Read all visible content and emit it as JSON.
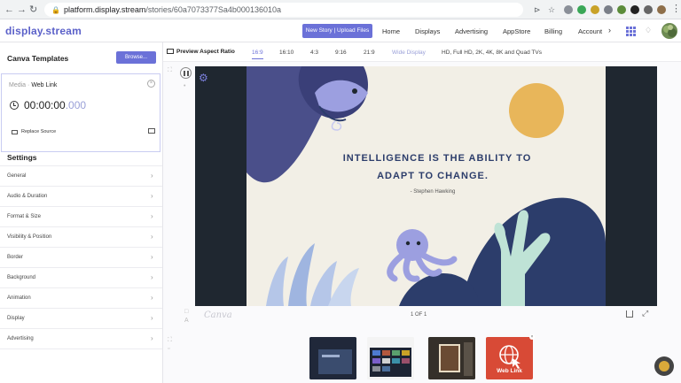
{
  "browser": {
    "url_host": "platform.display.stream",
    "url_path": "/stories/60a7073377Sa4b000136010a"
  },
  "app": {
    "logo": "display.stream",
    "new_story_button": "New Story | Upload Files",
    "nav": [
      "Home",
      "Displays",
      "Advertising",
      "AppStore",
      "Billing",
      "Account"
    ]
  },
  "left_panel": {
    "title": "Canva Templates",
    "browse_button": "Browse...",
    "media_prefix": "Media",
    "media_type": "Web Link",
    "timer_main": "00:00:00",
    "timer_ms": ".000",
    "replace_source": "Replace Source",
    "settings_title": "Settings",
    "settings_items": [
      "General",
      "Audio & Duration",
      "Format & Size",
      "Visibility & Position",
      "Border",
      "Background",
      "Animation",
      "Display",
      "Advertising"
    ]
  },
  "preview_toolbar": {
    "label": "Preview Aspect Ratio",
    "ratios": [
      "16:9",
      "16:10",
      "4:3",
      "9:16",
      "21:9"
    ],
    "active_ratio": "16:9",
    "wide_display": "Wide Display",
    "hd_options": "HD, Full HD, 2K, 4K, 8K and Quad TVs"
  },
  "slide": {
    "quote_line1": "INTELLIGENCE IS THE ABILITY TO",
    "quote_line2": "ADAPT TO CHANGE.",
    "author": "- Stephen Hawking",
    "canva_watermark": "Canva",
    "pager": "1 OF 1"
  },
  "thumbnails": {
    "web_link_label": "Web Link"
  },
  "colors": {
    "accent": "#6b71d8",
    "slide_bg": "#f2efe6",
    "navy": "#2c3d6b",
    "lavender": "#9c9fe0",
    "mint": "#bfe3d6",
    "sun": "#e8b65a",
    "web_link_red": "#d84a36"
  }
}
